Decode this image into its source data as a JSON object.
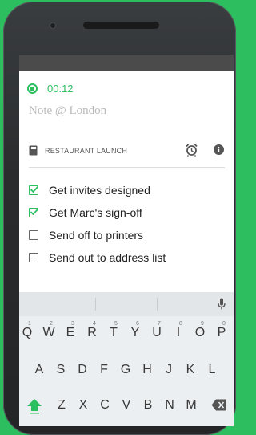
{
  "timer": {
    "elapsed": "00:12"
  },
  "note": {
    "title_placeholder": "Note @ London"
  },
  "notebook": {
    "name": "RESTAURANT LAUNCH"
  },
  "checklist": [
    {
      "label": "Get invites designed",
      "checked": true
    },
    {
      "label": "Get Marc's sign-off",
      "checked": true
    },
    {
      "label": "Send off to printers",
      "checked": false
    },
    {
      "label": "Send out to address list",
      "checked": false
    }
  ],
  "keyboard": {
    "row1": [
      "Q",
      "W",
      "E",
      "R",
      "T",
      "Y",
      "U",
      "I",
      "O",
      "P"
    ],
    "row1_numbers": [
      "1",
      "2",
      "3",
      "4",
      "5",
      "6",
      "7",
      "8",
      "9",
      "0"
    ],
    "row2": [
      "A",
      "S",
      "D",
      "F",
      "G",
      "H",
      "J",
      "K",
      "L"
    ],
    "row3": [
      "Z",
      "X",
      "C",
      "V",
      "B",
      "N",
      "M"
    ]
  },
  "colors": {
    "accent": "#2dbe60",
    "background": "#2dbe60",
    "status_bar": "#4b4b4b"
  },
  "icons": [
    "stop-icon",
    "notebook-icon",
    "alarm-icon",
    "info-icon",
    "checkbox-icon",
    "mic-icon",
    "shift-icon",
    "backspace-icon"
  ]
}
